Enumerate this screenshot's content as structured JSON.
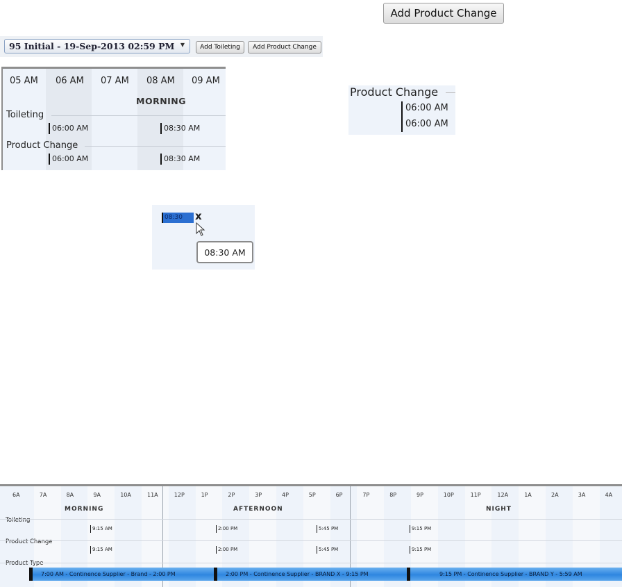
{
  "top_button": {
    "label": "Add Product Change"
  },
  "toolbar": {
    "selected": "95 Initial - 19-Sep-2013 02:59 PM",
    "add_toileting": "Add Toileting",
    "add_product_change": "Add Product Change"
  },
  "schedule_small": {
    "hours": [
      "05 AM",
      "06 AM",
      "07 AM",
      "08 AM",
      "09 AM"
    ],
    "period": "MORNING",
    "rows": [
      {
        "label": "Toileting",
        "times": [
          "06:00 AM",
          "08:30 AM"
        ]
      },
      {
        "label": "Product Change",
        "times": [
          "06:00 AM",
          "08:30 AM"
        ]
      }
    ]
  },
  "product_change_panel": {
    "title": "Product Change",
    "times": [
      "06:00 AM",
      "06:00 AM"
    ]
  },
  "tooltip_panel": {
    "chip_text": "08:30",
    "close_glyph": "x",
    "tooltip": "08:30 AM"
  },
  "schedule_large": {
    "hours": [
      "6A",
      "7A",
      "8A",
      "9A",
      "10A",
      "11A",
      "12P",
      "1P",
      "2P",
      "3P",
      "4P",
      "5P",
      "6P",
      "7P",
      "8P",
      "9P",
      "10P",
      "11P",
      "12A",
      "1A",
      "2A",
      "3A",
      "4A"
    ],
    "periods": [
      "MORNING",
      "AFTERNOON",
      "NIGHT"
    ],
    "rows": {
      "toileting": {
        "label": "Toileting",
        "times": [
          "9:15 AM",
          "2:00 PM",
          "5:45 PM",
          "9:15 PM"
        ]
      },
      "product_change": {
        "label": "Product Change",
        "times": [
          "9:15 AM",
          "2:00 PM",
          "5:45 PM",
          "9:15 PM"
        ]
      },
      "product_type": {
        "label": "Product Type",
        "bars": [
          "7:00 AM - Continence Supplier - Brand - 2:00 PM",
          "2:00 PM - Continence Supplier - BRAND X - 9:15 PM",
          "9:15 PM - Continence Supplier - BRAND Y - 5:59 AM"
        ]
      }
    }
  }
}
